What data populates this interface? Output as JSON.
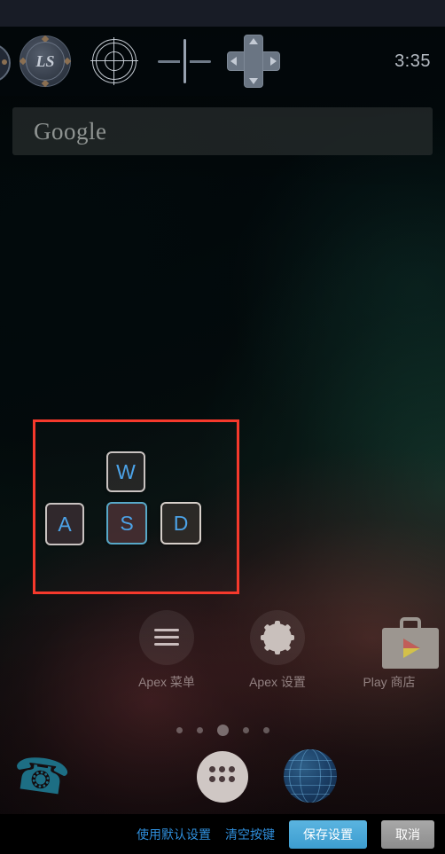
{
  "status_bar": {
    "clock": "3:35"
  },
  "game_toolbar": {
    "icons": [
      {
        "name": "joystick-partial-icon",
        "label": ""
      },
      {
        "name": "left-stick-icon",
        "label": "LS"
      },
      {
        "name": "aim-target-icon",
        "label": ""
      },
      {
        "name": "crosshair-icon",
        "label": ""
      },
      {
        "name": "dpad-icon",
        "label": ""
      }
    ]
  },
  "search_widget": {
    "logo": "Google",
    "placeholder": "Google"
  },
  "key_mapping": {
    "selection_color": "#f5392c",
    "keys": [
      {
        "id": "w",
        "label": "W",
        "selected": false
      },
      {
        "id": "a",
        "label": "A",
        "selected": false
      },
      {
        "id": "s",
        "label": "S",
        "selected": true
      },
      {
        "id": "d",
        "label": "D",
        "selected": false
      }
    ]
  },
  "home_screen": {
    "apps": [
      {
        "name": "apex-menu",
        "label": "Apex 菜单",
        "icon": "hamburger-icon"
      },
      {
        "name": "apex-settings",
        "label": "Apex 设置",
        "icon": "gear-icon"
      },
      {
        "name": "play-store",
        "label": "Play 商店",
        "icon": "play-store-icon"
      }
    ],
    "page_dots": {
      "count": 5,
      "active_index": 2
    },
    "dock": [
      {
        "name": "phone",
        "icon": "phone-icon"
      },
      {
        "name": "app-drawer",
        "icon": "app-drawer-icon"
      },
      {
        "name": "browser",
        "icon": "globe-icon"
      }
    ]
  },
  "bottom_bar": {
    "use_default_label": "使用默认设置",
    "clear_keys_label": "清空按键",
    "save_label": "保存设置",
    "cancel_label": "取消",
    "link_color": "#2f8fdd",
    "save_color": "#4ea8d8"
  }
}
